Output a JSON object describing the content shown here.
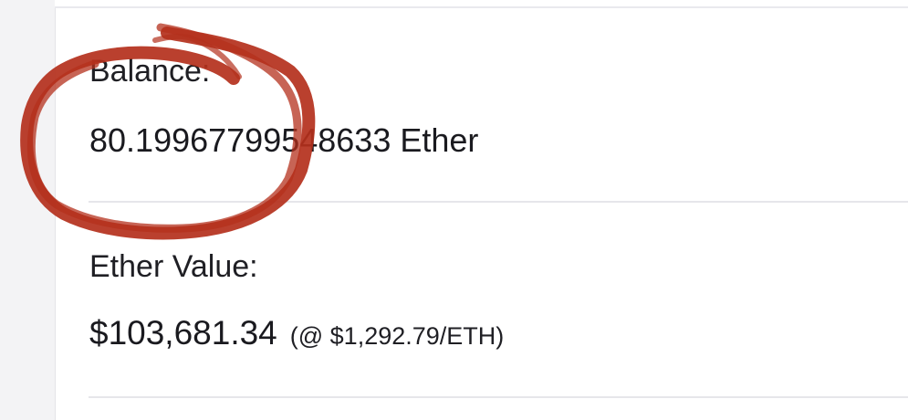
{
  "balance": {
    "label": "Balance:",
    "value": "80.19967799548633 Ether"
  },
  "ether_value": {
    "label": "Ether Value:",
    "usd_value": "$103,681.34",
    "rate": "(@ $1,292.79/ETH)"
  },
  "annotation": {
    "shape": "hand-drawn circle",
    "color": "#b4301c"
  },
  "colors": {
    "background": "#ffffff",
    "gutter": "#f3f3f5",
    "divider": "#e6e6ea",
    "text": "#1f1f24"
  }
}
